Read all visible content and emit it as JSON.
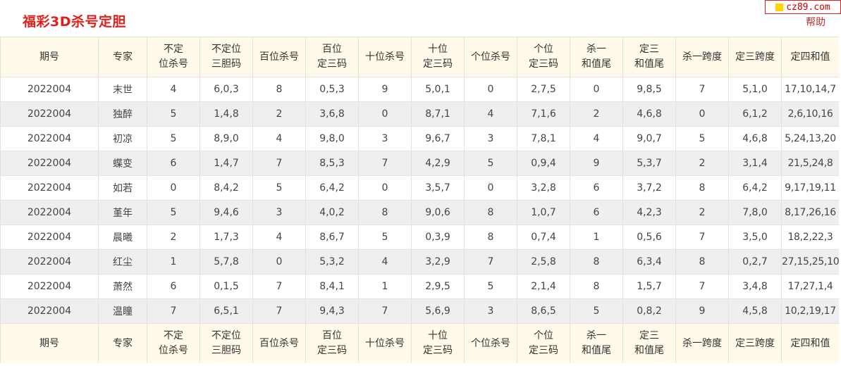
{
  "page": {
    "title": "福彩3D杀号定胆",
    "brand": "cz89.com",
    "help_label": "帮助"
  },
  "table": {
    "headers": [
      {
        "line1": "期号",
        "line2": ""
      },
      {
        "line1": "专家",
        "line2": ""
      },
      {
        "line1": "不定",
        "line2": "位杀号"
      },
      {
        "line1": "不定位",
        "line2": "三胆码"
      },
      {
        "line1": "百位杀号",
        "line2": ""
      },
      {
        "line1": "百位",
        "line2": "定三码"
      },
      {
        "line1": "十位杀号",
        "line2": ""
      },
      {
        "line1": "十位",
        "line2": "定三码"
      },
      {
        "line1": "个位杀号",
        "line2": ""
      },
      {
        "line1": "个位",
        "line2": "定三码"
      },
      {
        "line1": "杀一",
        "line2": "和值尾"
      },
      {
        "line1": "定三",
        "line2": "和值尾"
      },
      {
        "line1": "杀一跨度",
        "line2": ""
      },
      {
        "line1": "定三跨度",
        "line2": ""
      },
      {
        "line1": "定四和值",
        "line2": ""
      }
    ],
    "rows": [
      [
        "2022004",
        "末世",
        "4",
        "6,0,3",
        "8",
        "0,5,3",
        "9",
        "5,0,1",
        "0",
        "2,7,5",
        "0",
        "9,8,5",
        "7",
        "5,1,0",
        "17,10,14,7"
      ],
      [
        "2022004",
        "独醉",
        "5",
        "1,4,8",
        "2",
        "3,6,8",
        "0",
        "8,7,1",
        "4",
        "7,1,6",
        "2",
        "4,6,8",
        "0",
        "6,1,2",
        "2,6,10,16"
      ],
      [
        "2022004",
        "初凉",
        "5",
        "8,9,0",
        "4",
        "9,8,0",
        "3",
        "9,6,7",
        "3",
        "7,8,1",
        "4",
        "9,0,7",
        "5",
        "4,6,8",
        "5,24,13,20"
      ],
      [
        "2022004",
        "蝶变",
        "6",
        "1,4,7",
        "7",
        "8,5,3",
        "7",
        "4,2,9",
        "5",
        "0,9,4",
        "9",
        "5,3,7",
        "2",
        "3,1,4",
        "21,5,24,8"
      ],
      [
        "2022004",
        "如若",
        "0",
        "8,4,2",
        "5",
        "6,4,2",
        "0",
        "3,5,7",
        "0",
        "3,2,8",
        "6",
        "3,7,2",
        "8",
        "6,4,2",
        "9,17,19,11"
      ],
      [
        "2022004",
        "堇年",
        "5",
        "9,4,6",
        "3",
        "4,0,2",
        "8",
        "9,0,6",
        "8",
        "1,0,7",
        "6",
        "4,2,3",
        "2",
        "7,8,0",
        "8,17,26,16"
      ],
      [
        "2022004",
        "晨曦",
        "2",
        "1,7,3",
        "4",
        "8,6,7",
        "5",
        "0,3,9",
        "8",
        "0,7,4",
        "1",
        "0,5,6",
        "7",
        "3,5,0",
        "18,2,22,3"
      ],
      [
        "2022004",
        "红尘",
        "1",
        "5,7,8",
        "0",
        "5,3,2",
        "4",
        "3,2,9",
        "7",
        "2,5,8",
        "8",
        "6,3,4",
        "8",
        "0,2,7",
        "27,15,25,10"
      ],
      [
        "2022004",
        "萧然",
        "6",
        "0,1,5",
        "7",
        "8,4,1",
        "1",
        "2,9,5",
        "5",
        "2,1,4",
        "8",
        "1,5,7",
        "7",
        "3,4,8",
        "17,27,1,4"
      ],
      [
        "2022004",
        "温瞳",
        "7",
        "6,5,1",
        "7",
        "9,4,3",
        "7",
        "5,6,9",
        "3",
        "8,6,5",
        "5",
        "0,8,2",
        "9",
        "4,5,8",
        "10,2,19,17"
      ]
    ]
  },
  "colors": {
    "title": "#e0201b",
    "header_bg": "#fffae9",
    "alt_row_bg": "#efefef",
    "border": "#e6e2d4"
  }
}
